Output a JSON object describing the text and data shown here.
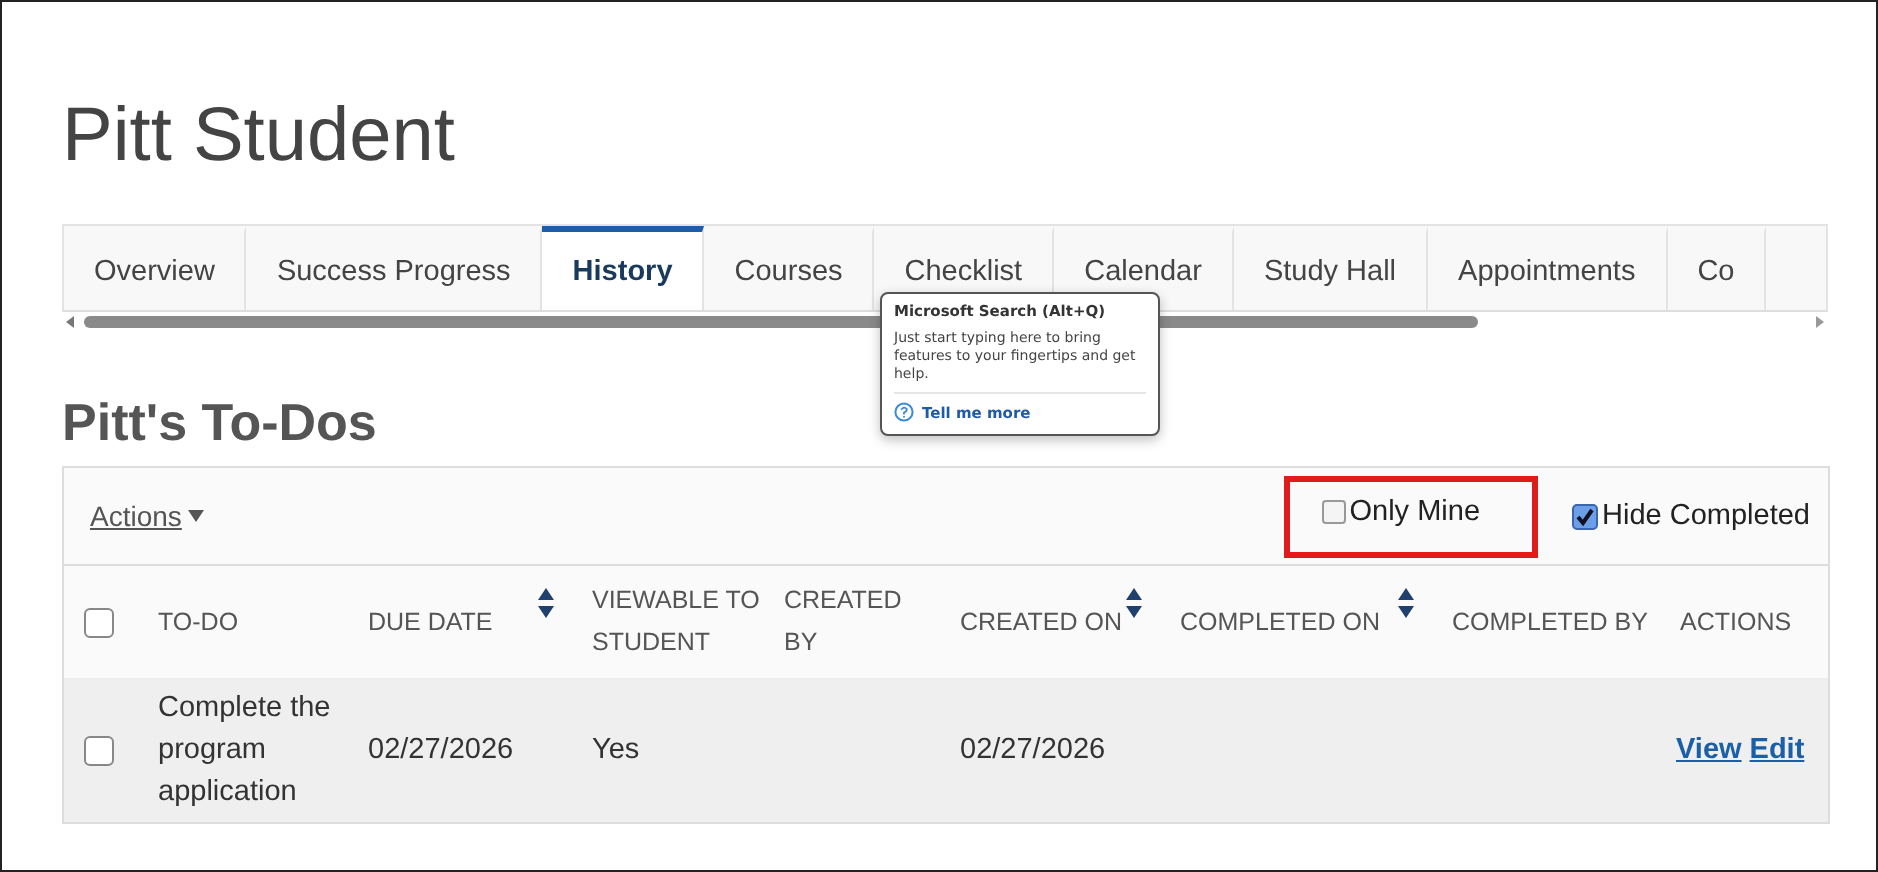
{
  "page_title": "Pitt Student",
  "tabs": [
    {
      "label": "Overview",
      "selected": false
    },
    {
      "label": "Success Progress",
      "selected": false
    },
    {
      "label": "History",
      "selected": true
    },
    {
      "label": "Courses",
      "selected": false
    },
    {
      "label": "Checklist",
      "selected": false
    },
    {
      "label": "Calendar",
      "selected": false
    },
    {
      "label": "Study Hall",
      "selected": false
    },
    {
      "label": "Appointments",
      "selected": false
    },
    {
      "label": "Co",
      "selected": false
    }
  ],
  "tooltip": {
    "title": "Microsoft Search (Alt+Q)",
    "body": "Just start typing here to bring features to your fingertips and get help.",
    "link": "Tell me more"
  },
  "section_title": "Pitt's To-Dos",
  "toolbar": {
    "actions": "Actions",
    "filters": [
      {
        "label": "Only Mine",
        "checked": false,
        "highlighted": true
      },
      {
        "label": "Hide Completed",
        "checked": true,
        "highlighted": false
      }
    ]
  },
  "table": {
    "select_all_checked": false,
    "columns": [
      {
        "label": "TO-DO",
        "sortable": false
      },
      {
        "label": "DUE DATE",
        "sortable": true
      },
      {
        "label": "VIEWABLE TO STUDENT",
        "sortable": false
      },
      {
        "label": "CREATED BY",
        "sortable": false
      },
      {
        "label": "CREATED ON",
        "sortable": true
      },
      {
        "label": "COMPLETED ON",
        "sortable": true
      },
      {
        "label": "COMPLETED BY",
        "sortable": false
      },
      {
        "label": "ACTIONS",
        "sortable": false
      }
    ],
    "rows": [
      {
        "checked": false,
        "cells": [
          "Complete the program application",
          "02/27/2026",
          "Yes",
          "",
          "02/27/2026",
          "",
          ""
        ],
        "links": [
          "View",
          "Edit"
        ]
      }
    ]
  }
}
